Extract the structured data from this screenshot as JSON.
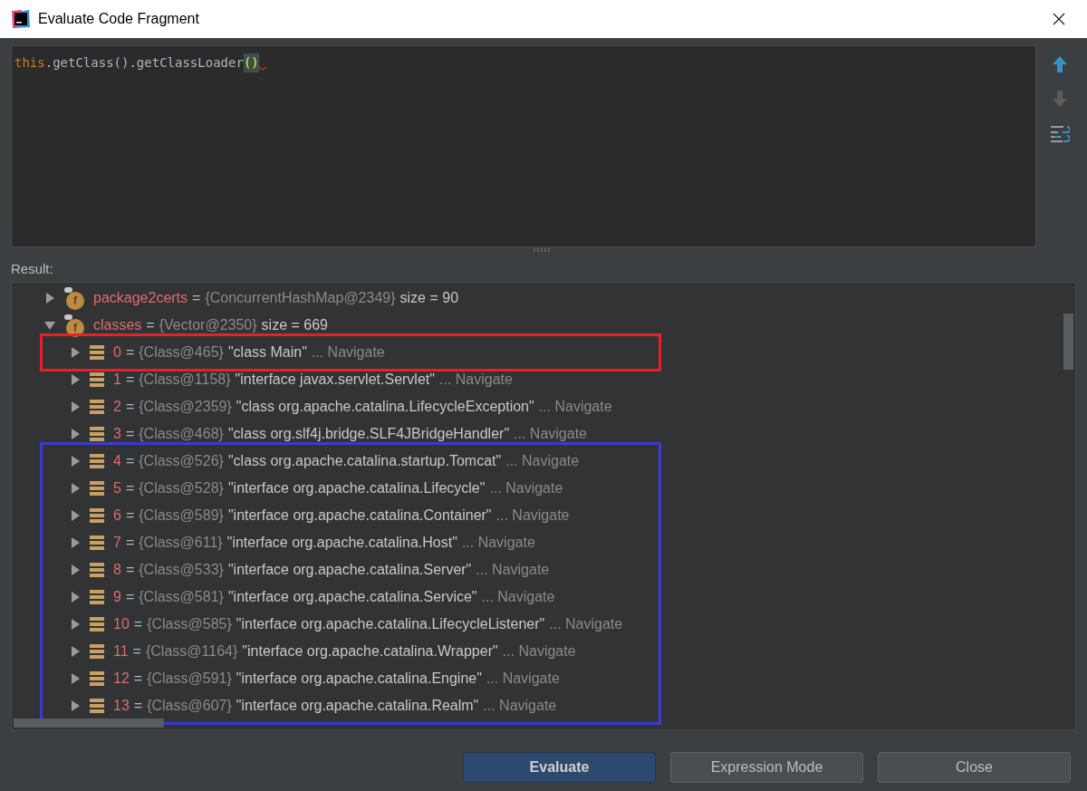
{
  "window": {
    "title": "Evaluate Code Fragment"
  },
  "editor": {
    "tokens": [
      {
        "kind": "keyword",
        "text": "this"
      },
      {
        "kind": "plain",
        "text": ".getClass().getClassLoader"
      },
      {
        "kind": "brace",
        "text": "()"
      }
    ],
    "error": true
  },
  "result_label": "Result:",
  "tree": [
    {
      "kind": "field",
      "badge": "f",
      "name": "package2certs",
      "eq": "=",
      "type": "{ConcurrentHashMap@2349}",
      "value": "size = 90",
      "expanded": false
    },
    {
      "kind": "field",
      "badge": "f",
      "name": "classes",
      "eq": "=",
      "type": "{Vector@2350}",
      "value": "size = 669",
      "expanded": true,
      "groups": [
        {
          "color": "#e8202a",
          "items": [
            {
              "name": "0",
              "eq": "=",
              "type": "{Class@465}",
              "value": "\"class Main\"",
              "link": "... Navigate",
              "expanded": false
            }
          ]
        },
        {
          "items": [
            {
              "name": "1",
              "eq": "=",
              "type": "{Class@1158}",
              "value": "\"interface javax.servlet.Servlet\"",
              "link": "... Navigate",
              "expanded": false
            },
            {
              "name": "2",
              "eq": "=",
              "type": "{Class@2359}",
              "value": "\"class org.apache.catalina.LifecycleException\"",
              "link": "... Navigate",
              "expanded": false
            },
            {
              "name": "3",
              "eq": "=",
              "type": "{Class@468}",
              "value": "\"class org.slf4j.bridge.SLF4JBridgeHandler\"",
              "link": "... Navigate",
              "expanded": false
            }
          ]
        },
        {
          "color": "#3a3ad0",
          "items": [
            {
              "name": "4",
              "eq": "=",
              "type": "{Class@526}",
              "value": "\"class org.apache.catalina.startup.Tomcat\"",
              "link": "... Navigate",
              "expanded": false
            },
            {
              "name": "5",
              "eq": "=",
              "type": "{Class@528}",
              "value": "\"interface org.apache.catalina.Lifecycle\"",
              "link": "... Navigate",
              "expanded": false
            },
            {
              "name": "6",
              "eq": "=",
              "type": "{Class@589}",
              "value": "\"interface org.apache.catalina.Container\"",
              "link": "... Navigate",
              "expanded": false
            },
            {
              "name": "7",
              "eq": "=",
              "type": "{Class@611}",
              "value": "\"interface org.apache.catalina.Host\"",
              "link": "... Navigate",
              "expanded": false
            },
            {
              "name": "8",
              "eq": "=",
              "type": "{Class@533}",
              "value": "\"interface org.apache.catalina.Server\"",
              "link": "... Navigate",
              "expanded": false
            },
            {
              "name": "9",
              "eq": "=",
              "type": "{Class@581}",
              "value": "\"interface org.apache.catalina.Service\"",
              "link": "... Navigate",
              "expanded": false
            },
            {
              "name": "10",
              "eq": "=",
              "type": "{Class@585}",
              "value": "\"interface org.apache.catalina.LifecycleListener\"",
              "link": "... Navigate",
              "expanded": false
            },
            {
              "name": "11",
              "eq": "=",
              "type": "{Class@1164}",
              "value": "\"interface org.apache.catalina.Wrapper\"",
              "link": "... Navigate",
              "expanded": false
            },
            {
              "name": "12",
              "eq": "=",
              "type": "{Class@591}",
              "value": "\"interface org.apache.catalina.Engine\"",
              "link": "... Navigate",
              "expanded": false
            },
            {
              "name": "13",
              "eq": "=",
              "type": "{Class@607}",
              "value": "\"interface org.apache.catalina.Realm\"",
              "link": "... Navigate",
              "expanded": false
            }
          ]
        }
      ]
    }
  ],
  "buttons": [
    {
      "label": "Evaluate",
      "kind": "primary"
    },
    {
      "label": "Expression Mode",
      "kind": "normal"
    },
    {
      "label": "Close",
      "kind": "normal"
    }
  ]
}
